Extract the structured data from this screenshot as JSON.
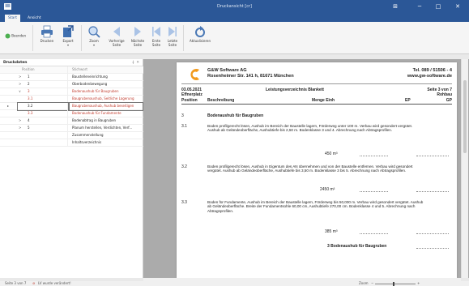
{
  "window": {
    "title": "Druckansicht [cr]",
    "controls": {
      "help": "⊞",
      "minimize": "─",
      "maximize": "□",
      "close": "✕"
    }
  },
  "tabs": [
    "Start",
    "Ansicht"
  ],
  "ribbon": {
    "buttons": [
      {
        "label": "Beenden",
        "icon": "exit-icon"
      },
      {
        "label": "Drucken",
        "icon": "printer-icon"
      },
      {
        "label": "Export",
        "icon": "export-icon"
      },
      {
        "label": "Zoom",
        "icon": "zoom-icon"
      },
      {
        "label": "Vorherige Seite",
        "icon": "previous-page-icon"
      },
      {
        "label": "Nächste Seite",
        "icon": "next-page-icon"
      },
      {
        "label": "Erste Seite",
        "icon": "first-page-icon"
      },
      {
        "label": "Letzte Seite",
        "icon": "last-page-icon"
      },
      {
        "label": "Aktualisieren",
        "icon": "refresh-icon"
      }
    ]
  },
  "panel": {
    "title": "Druckdaten",
    "pin": "ǂ",
    "close": "✕",
    "columns": [
      "Position",
      "Stichwort"
    ],
    "rows": [
      {
        "exp": ">",
        "pos": "1",
        "text": "Baustelleneinrichtung",
        "red": false
      },
      {
        "exp": ">",
        "pos": "2",
        "text": "Oberbodenbewegung",
        "red": false
      },
      {
        "exp": "∨",
        "pos": "3",
        "text": "Bodenaushub für Baugruben",
        "red": true
      },
      {
        "exp": "",
        "pos": "3.1",
        "text": "Baugrubenaushub, Seitliche Lagerung",
        "red": true
      },
      {
        "exp": "",
        "pos": "3.2",
        "text": "Baugrubenaushub, Aushub beseitigen",
        "red": true
      },
      {
        "exp": "",
        "pos": "3.3",
        "text": "Bodenaushub für Fundamente",
        "red": true
      },
      {
        "exp": ">",
        "pos": "4",
        "text": "Bodenabtrag in Baugruben",
        "red": false
      },
      {
        "exp": ">",
        "pos": "5",
        "text": "Planum herstellen, Verdichten, Verf...",
        "red": false
      },
      {
        "exp": "",
        "pos": "",
        "text": "Zusammenstellung",
        "red": false
      },
      {
        "exp": "",
        "pos": "",
        "text": "Inhaltsverzeichnis",
        "red": false
      }
    ]
  },
  "document": {
    "company": "G&W Software AG",
    "address": "Rosenheimer Str. 141 h, 81671 München",
    "phone": "Tel. 089 / 51506 - 4",
    "web": "www.gw-software.de",
    "date": "03.05.2021",
    "place": "Effnerplatz",
    "heading": "Leistungsverzeichnis Blankett",
    "page_info": "Seite 3 von 7",
    "section": "Rohbau",
    "col_position": "Position",
    "col_beschreibung": "Beschreibung",
    "col_menge": "Menge Einh",
    "col_ep": "EP",
    "col_gp": "GP",
    "group_nr": "3",
    "group_title": "Bodenaushub für Baugruben",
    "items": [
      {
        "nr": "3.1",
        "text": "Boden profilgerecht lösen, Aushub im Bereich der Baustelle lagern, Förderweg unter 100 m. Verbau wird gesondert vergütet. Aushub ab Geländeoberfläche, Aushubtiefe bis 2,50 m. Bodenklasse 3 und 4. Abrechnung nach Abtragsprofilen.",
        "qty": "450 m³"
      },
      {
        "nr": "3.2",
        "text": "Boden profilgerecht lösen, Aushub in Eigentum des AN übernehmen und von der Baustelle entfernen. Verbau wird gesondert vergütet. Aushub ab Geländeoberfläche, Aushubtiefe bis 3,50 m. Bodenklasse 3 bis 5. Abrechnung nach Abtragsprofilen.",
        "qty": "2450 m³"
      },
      {
        "nr": "3.3",
        "text": "Boden für Fundamente, Aushub im Bereich der Baustelle lagern, Förderweg bis 50,000 m. Verbau wird gesondert vergütet. Aushub ab Geländeoberfläche. Breite der Fundamentsohle 60,00 cm, Aushubtiefe 270,00 cm. Bodenklasse 4 und 5. Abrechnung nach Abtragsprofilen.",
        "qty": "385 m³"
      }
    ],
    "sum_label": "3 Bodenaushub für Baugruben"
  },
  "status": {
    "page": "Seite 3 von 7",
    "message": "LV wurde verändert!",
    "zoom_label": "Zoom",
    "zoom_minus": "−",
    "zoom_plus": "+"
  },
  "colors": {
    "accent": "#2b5797",
    "logo": "#f29a1c",
    "red_text": "#c0392b"
  }
}
